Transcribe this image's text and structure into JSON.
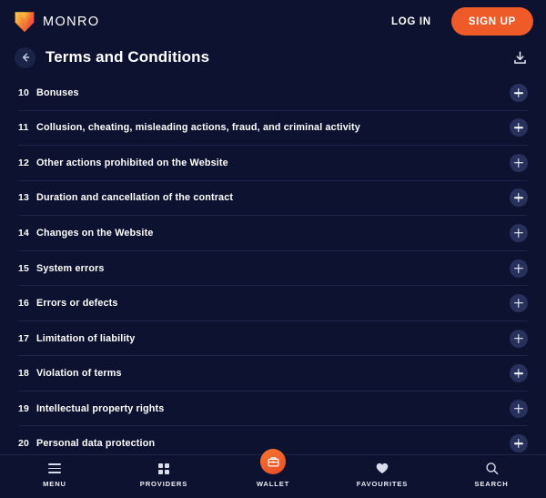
{
  "theme": {
    "background": "#0d1230",
    "divider": "#1d2447",
    "accent_orange": "#ef5a29",
    "pill_blue": "#28315c",
    "back_button_blue": "#1b2348",
    "text": "#ffffff"
  },
  "topbar": {
    "brand_name": "MONRO",
    "logo_icon": "monro-v-shield-logo",
    "login_label": "LOG IN",
    "signup_label": "SIGN UP"
  },
  "page_header": {
    "back_icon": "arrow-left-icon",
    "title": "Terms and Conditions",
    "download_icon": "download-icon"
  },
  "terms": {
    "expand_icon": "plus-icon",
    "items": [
      {
        "number": "10",
        "label": "Bonuses"
      },
      {
        "number": "11",
        "label": "Collusion, cheating, misleading actions, fraud, and criminal activity"
      },
      {
        "number": "12",
        "label": "Other actions prohibited on the Website"
      },
      {
        "number": "13",
        "label": "Duration and cancellation of the contract"
      },
      {
        "number": "14",
        "label": "Changes on the Website"
      },
      {
        "number": "15",
        "label": "System errors"
      },
      {
        "number": "16",
        "label": "Errors or defects"
      },
      {
        "number": "17",
        "label": "Limitation of liability"
      },
      {
        "number": "18",
        "label": "Violation of terms"
      },
      {
        "number": "19",
        "label": "Intellectual property rights"
      },
      {
        "number": "20",
        "label": "Personal data protection"
      }
    ]
  },
  "bottom_nav": {
    "items": [
      {
        "label": "MENU",
        "icon": "hamburger-menu-icon"
      },
      {
        "label": "PROVIDERS",
        "icon": "grid-providers-icon"
      },
      {
        "label": "WALLET",
        "icon": "wallet-icon"
      },
      {
        "label": "FAVOURITES",
        "icon": "heart-icon"
      },
      {
        "label": "SEARCH",
        "icon": "magnifier-icon"
      }
    ]
  }
}
